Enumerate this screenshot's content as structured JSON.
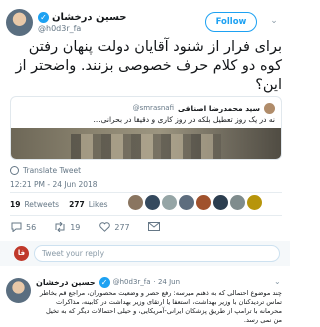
{
  "header": {
    "name": "حسین درخشان",
    "handle": "@h0d3r_fa",
    "follow_label": "Follow",
    "chevron": "⌄"
  },
  "tweet": {
    "text": "برای فرار از شنود آقایان دولت پنهان رفتن کوه دو کلام حرف خصوصی بزنند. واضحتر از این؟"
  },
  "quote": {
    "name": "سید محمدرضا اصنافی",
    "handle": "@smrasnafi",
    "text": "نه در یک روز تعطیل بلکه در روز کاری و دقیقا در بحرانی..."
  },
  "translate_label": "Translate Tweet",
  "timestamp": "12:21 PM - 24 Jun 2018",
  "stats": {
    "retweets": "19",
    "retweets_label": "Retweets",
    "likes": "277",
    "likes_label": "Likes",
    "liker_colors": [
      "#8a7560",
      "#34495e",
      "#95a5a6",
      "#5d6d7e",
      "#a0522d",
      "#2c3e50",
      "#7f8c8d",
      "#b7950b"
    ]
  },
  "actions": {
    "replies": "56",
    "retweets": "19",
    "likes": "277"
  },
  "reply": {
    "placeholder": "Tweet your reply",
    "avatar_text": "فا"
  },
  "tweet2": {
    "name": "حسین درخشان",
    "handle": "@h0d3r_fa",
    "date": "· 24 Jun",
    "chevron": "⌄",
    "text": "چند موضوع احتمالی که به ذهنم میرسه: رفع حصر و وضعیت محصوران، مراجع قم بخاطر تماس تردیدکنان با وزیر بهداشت، استعفا یا ارتقای وزیر بهداشت در کابینه، مذاکرات محرمانه با ترامپ از طریق پزشکان ایرانی-آمریکایی، و حیلی احتمالات دیگر که به تخیل من نمی رسد."
  }
}
